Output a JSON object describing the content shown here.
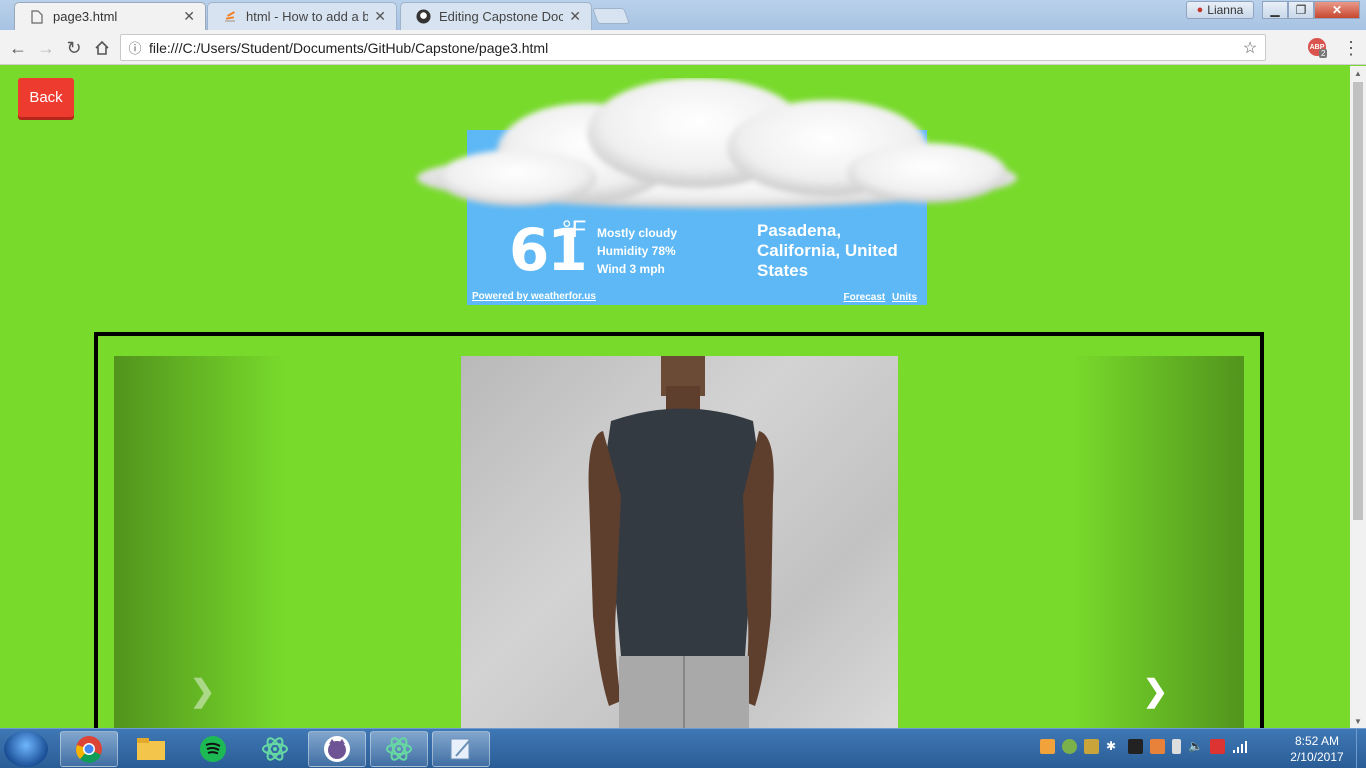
{
  "browser": {
    "tabs": [
      {
        "label": "page3.html",
        "icon": "page-icon",
        "active": true
      },
      {
        "label": "html - How to add a bord",
        "icon": "stackoverflow-icon",
        "active": false
      },
      {
        "label": "Editing Capstone Docum",
        "icon": "github-icon",
        "active": false
      }
    ],
    "profile_name": "Lianna",
    "url": "file:///C:/Users/Student/Documents/GitHub/Capstone/page3.html",
    "extension_badge": "ABP",
    "extension_count": "2"
  },
  "page": {
    "back_label": "Back",
    "weather": {
      "temperature": "61",
      "unit": "°F",
      "condition": "Mostly cloudy",
      "humidity": "Humidity 78%",
      "wind": "Wind 3 mph",
      "location": "Pasadena, California, United States",
      "powered_by": "Powered by weatherfor.us",
      "forecast_link": "Forecast",
      "units_link": "Units"
    },
    "carousel": {
      "prev_icon": "chevron-left-icon",
      "next_icon": "chevron-right-icon"
    }
  },
  "taskbar": {
    "apps": [
      "chrome",
      "file-explorer",
      "spotify",
      "atom",
      "github-desktop",
      "atom",
      "notepad"
    ],
    "time": "8:52 AM",
    "date": "2/10/2017"
  },
  "colors": {
    "page_background": "#78da2b",
    "back_button": "#ee3b2f",
    "weather_background": "#5db8f5"
  }
}
